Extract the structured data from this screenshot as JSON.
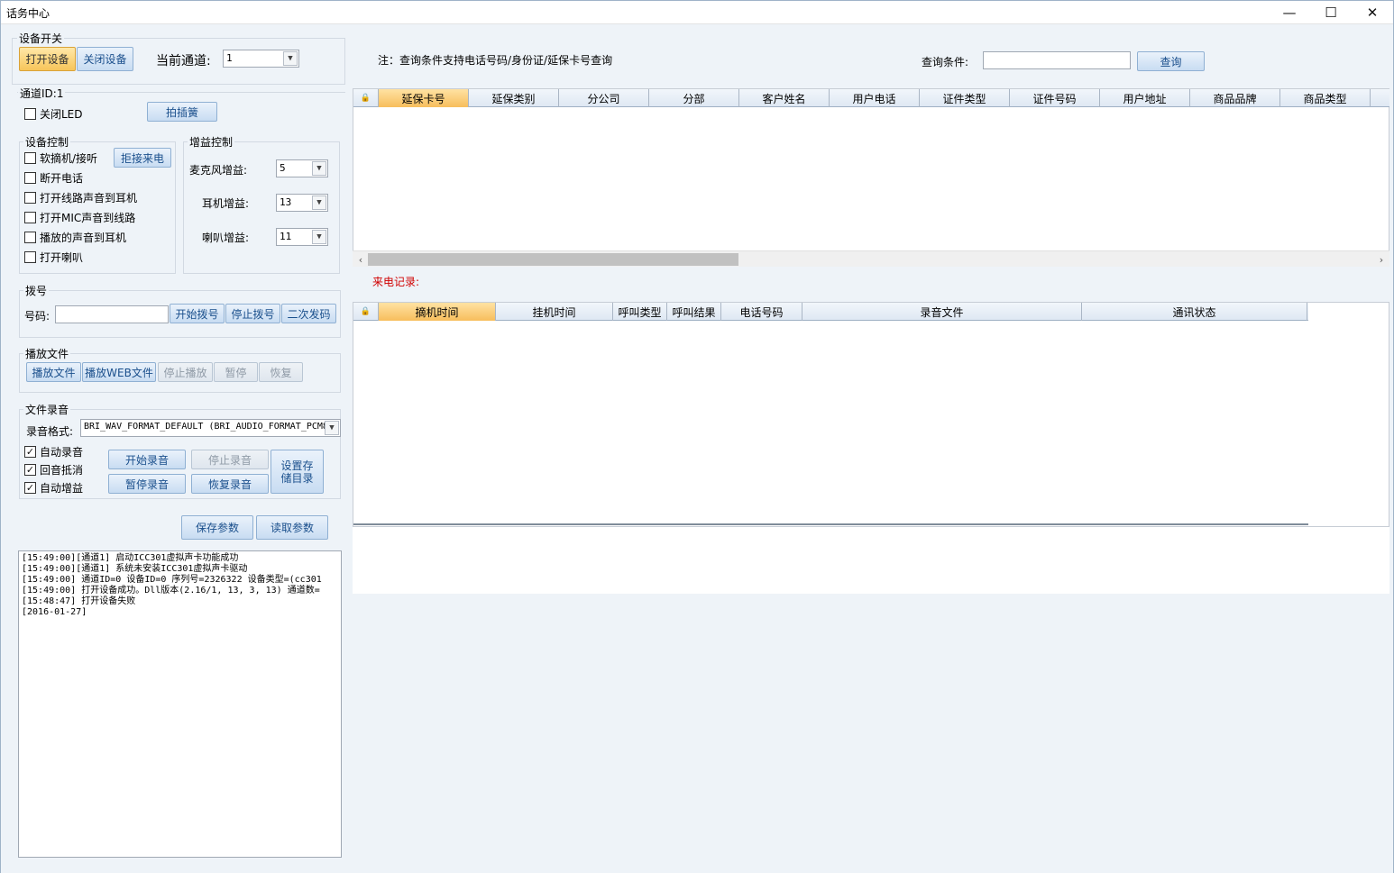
{
  "window": {
    "title": "话务中心",
    "controls": {
      "minimize": "—",
      "maximize": "☐",
      "close": "✕"
    }
  },
  "device_switch": {
    "group_title": "设备开关",
    "open_label": "打开设备",
    "close_label": "关闭设备",
    "current_channel_label": "当前通道:",
    "current_channel_value": "1"
  },
  "channel": {
    "id_label": "通道ID:1",
    "close_led_label": "关闭LED",
    "flash_label": "拍插簧"
  },
  "device_control": {
    "group_title": "设备控制",
    "reject_label": "拒接来电",
    "items": [
      {
        "label": "软摘机/接听",
        "checked": false
      },
      {
        "label": "断开电话",
        "checked": false
      },
      {
        "label": "打开线路声音到耳机",
        "checked": false
      },
      {
        "label": "打开MIC声音到线路",
        "checked": false
      },
      {
        "label": "播放的声音到耳机",
        "checked": false
      },
      {
        "label": "打开喇叭",
        "checked": false
      }
    ]
  },
  "gain_control": {
    "group_title": "增益控制",
    "mic_label": "麦克风增益:",
    "mic_value": "5",
    "earphone_label": "耳机增益:",
    "earphone_value": "13",
    "speaker_label": "喇叭增益:",
    "speaker_value": "11"
  },
  "dial": {
    "group_title": "拨号",
    "number_label": "号码:",
    "number_value": "",
    "start_label": "开始拨号",
    "stop_label": "停止拨号",
    "second_label": "二次发码"
  },
  "play": {
    "group_title": "播放文件",
    "play_label": "播放文件",
    "play_web_label": "播放WEB文件",
    "stop_label": "停止播放",
    "pause_label": "暂停",
    "resume_label": "恢复"
  },
  "record": {
    "group_title": "文件录音",
    "format_label": "录音格式:",
    "format_value": "BRI_WAV_FORMAT_DEFAULT (BRI_AUDIO_FORMAT_PCM8",
    "auto_record_label": "自动录音",
    "echo_cancel_label": "回音抵消",
    "auto_gain_label": "自动增益",
    "start_label": "开始录音",
    "stop_label": "停止录音",
    "pause_label": "暂停录音",
    "resume_label": "恢复录音",
    "set_dir_line1": "设置存",
    "set_dir_line2": "储目录"
  },
  "params": {
    "save_label": "保存参数",
    "load_label": "读取参数"
  },
  "log_lines": [
    "[15:49:00][通道1] 启动ICC301虚拟声卡功能成功",
    "[15:49:00][通道1] 系统未安装ICC301虚拟声卡驱动",
    "[15:49:00] 通道ID=0 设备ID=0 序列号=2326322 设备类型=(cc301",
    "[15:49:00] 打开设备成功。Dll版本(2.16/1, 13, 3, 13) 通道数=",
    "[15:48:47] 打开设备失败",
    "[2016-01-27]"
  ],
  "query": {
    "note": "注：查询条件支持电话号码/身份证/延保卡号查询",
    "condition_label": "查询条件:",
    "condition_value": "",
    "button_label": "查询"
  },
  "warranty_grid": {
    "corner_icon": "lock-icon",
    "columns": [
      "延保卡号",
      "延保类别",
      "分公司",
      "分部",
      "客户姓名",
      "用户电话",
      "证件类型",
      "证件号码",
      "用户地址",
      "商品品牌",
      "商品类型"
    ]
  },
  "incoming": {
    "label": "来电记录:",
    "corner_icon": "lock-icon",
    "columns": [
      "摘机时间",
      "挂机时间",
      "呼叫类型",
      "呼叫结果",
      "电话号码",
      "录音文件",
      "通讯状态"
    ]
  },
  "colors": {
    "accent": "#f7c55a",
    "button": "#c8dcf2",
    "incoming_label": "#d00000"
  }
}
